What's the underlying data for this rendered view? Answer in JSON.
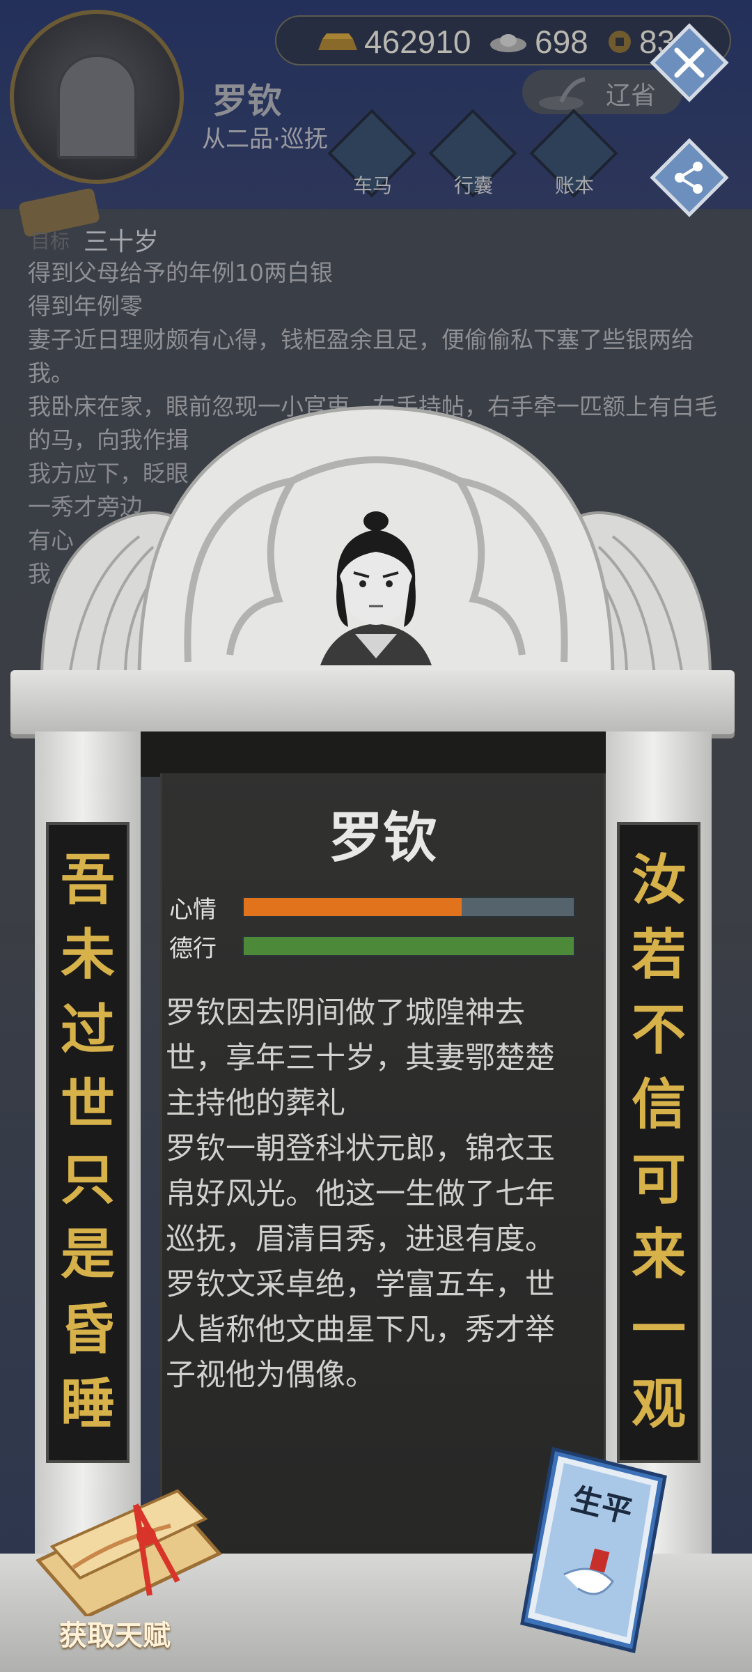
{
  "resources": {
    "gold": "462910",
    "silver": "698",
    "coin": "83"
  },
  "character": {
    "name": "罗钦",
    "rank": "从二品·巡抚",
    "location": "辽省"
  },
  "menu": [
    {
      "label": "车马"
    },
    {
      "label": "行囊"
    },
    {
      "label": "账本"
    }
  ],
  "goal": {
    "tag": "目标",
    "age": "三十岁"
  },
  "story": [
    "得到父母给予的年例10两白银",
    "得到年例零",
    "妻子近日理财颇有心得，钱柜盈余且足，便偷偷私下塞了些银两给我。",
    "我卧床在家，眼前忽现一小官吏，左手持帖，右手牵一匹额上有白毛的马，向我作揖",
    "我方应下，眨眼",
    "一秀才旁边",
    "有心",
    "我"
  ],
  "tombstone": {
    "name": "罗钦",
    "stats": [
      {
        "label": "心情",
        "value": 0.66
      },
      {
        "label": "德行",
        "value": 1.0
      }
    ],
    "epitaph": [
      "罗钦因去阴间做了城隍神去世，享年三十岁，其妻鄂楚楚主持他的葬礼",
      "罗钦一朝登科状元郎，锦衣玉帛好风光。他这一生做了七年巡抚，眉清目秀，进退有度。罗钦文采卓绝，学富五车，世人皆称他文曲星下凡，秀才举子视他为偶像。"
    ],
    "couplet_left": [
      "吾",
      "未",
      "过",
      "世",
      "只",
      "是",
      "昏",
      "睡"
    ],
    "couplet_right": [
      "汝",
      "若",
      "不",
      "信",
      "可",
      "来",
      "一",
      "观"
    ]
  },
  "buttons": {
    "talent": "获取天赋",
    "book_title": "生平"
  },
  "colors": {
    "mood": "#e2731d",
    "virtue": "#4c8a3a",
    "couplet_text": "#d7b24a",
    "button_blue": "#6d8fbd"
  }
}
